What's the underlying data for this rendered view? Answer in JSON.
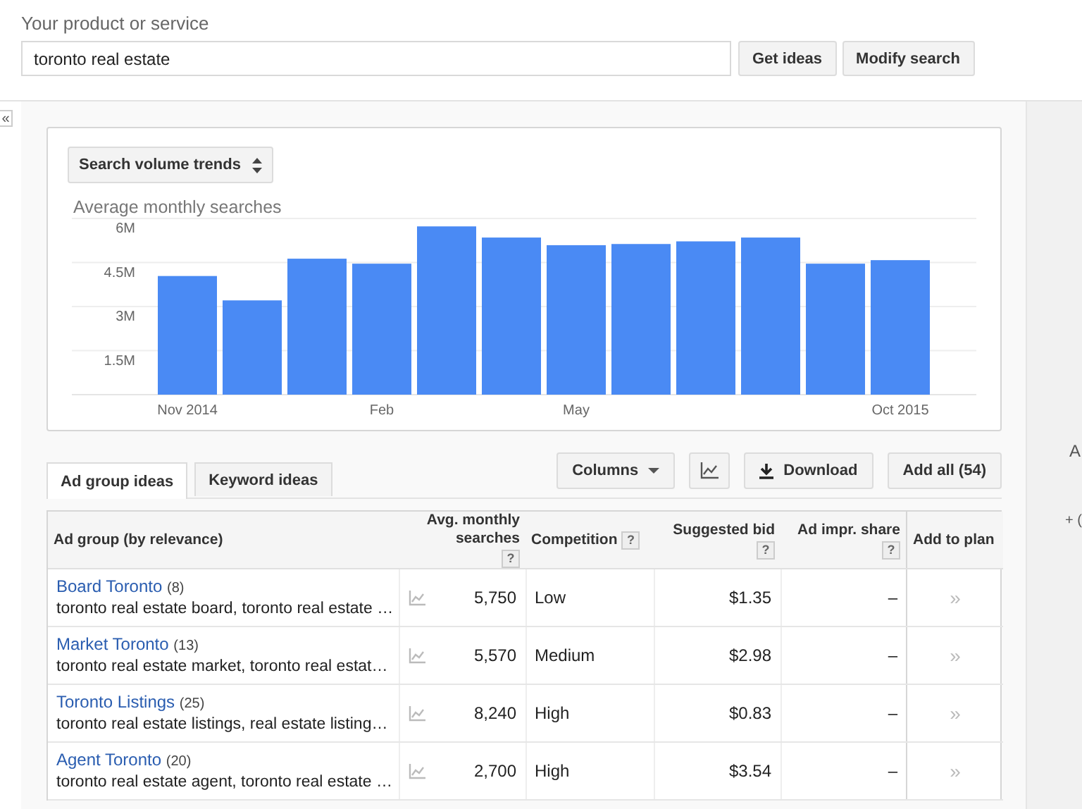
{
  "search": {
    "label": "Your product or service",
    "value": "toronto real estate"
  },
  "search_buttons": [
    "Get ideas",
    "Modify search"
  ],
  "collapse_button": "«",
  "chart_panel": {
    "selector": "Search volume trends",
    "chart_data": {
      "type": "bar",
      "title": "Average monthly searches",
      "grid": true,
      "categories": [
        "Nov 2014",
        null,
        null,
        "Feb",
        null,
        null,
        "May",
        null,
        null,
        null,
        null,
        "Oct 2015"
      ],
      "values": [
        4.04,
        3.21,
        4.63,
        4.46,
        5.73,
        5.35,
        5.09,
        5.13,
        5.22,
        5.35,
        4.46,
        4.58
      ],
      "ylim": [
        0,
        6
      ],
      "yticks": [
        {
          "value": 1.5,
          "label": "1.5M"
        },
        {
          "value": 3,
          "label": "3M"
        },
        {
          "value": 4.5,
          "label": "4.5M"
        },
        {
          "value": 6,
          "label": "6M"
        }
      ]
    }
  },
  "tabs": [
    {
      "label": "Ad group ideas",
      "selected": true
    },
    {
      "label": "Keyword ideas",
      "selected": false
    }
  ],
  "toolbar": [
    {
      "kind": "dropdown",
      "label": "Columns"
    },
    {
      "kind": "chart"
    },
    {
      "kind": "download",
      "label": "Download"
    },
    {
      "kind": "plain",
      "label": "Add all (54)"
    }
  ],
  "table": {
    "columns": [
      {
        "label": "Ad group (by relevance)"
      },
      {
        "label": "Avg. monthly searches",
        "help": "?"
      },
      {
        "label": "Competition",
        "help": "?"
      },
      {
        "label": "Suggested bid",
        "help": "?"
      },
      {
        "label": "Ad impr. share",
        "help": "?"
      },
      {
        "label": "Add to plan"
      }
    ],
    "rows": [
      {
        "name": "Board Toronto",
        "count": "(8)",
        "keywords": "toronto real estate board, toronto real estate …",
        "searches": "5,750",
        "competition": "Low",
        "bid": "$1.35",
        "impr_share": "–",
        "add": "»"
      },
      {
        "name": "Market Toronto",
        "count": "(13)",
        "keywords": "toronto real estate market, toronto real estat…",
        "searches": "5,570",
        "competition": "Medium",
        "bid": "$2.98",
        "impr_share": "–",
        "add": "»"
      },
      {
        "name": "Toronto Listings",
        "count": "(25)",
        "keywords": "toronto real estate listings, real estate listing…",
        "searches": "8,240",
        "competition": "High",
        "bid": "$0.83",
        "impr_share": "–",
        "add": "»"
      },
      {
        "name": "Agent Toronto",
        "count": "(20)",
        "keywords": "toronto real estate agent, toronto real estate …",
        "searches": "2,700",
        "competition": "High",
        "bid": "$3.54",
        "impr_share": "–",
        "add": "»"
      }
    ]
  },
  "side_panel": [
    "A",
    "+ ("
  ]
}
